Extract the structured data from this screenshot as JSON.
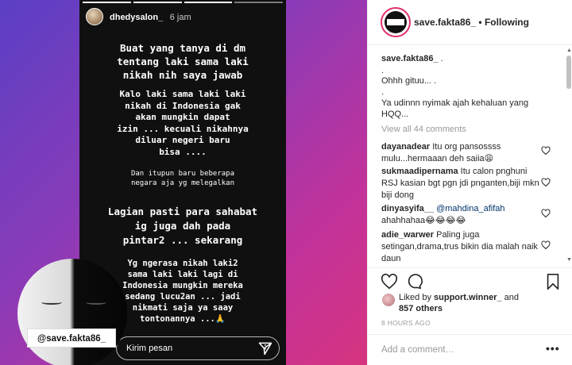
{
  "story": {
    "username": "dhedysalon_",
    "time": "6 jam",
    "text_block_1": "Buat yang tanya di dm\ntentang laki sama laki\nnikah nih saya jawab",
    "text_block_2": "Kalo laki sama laki laki\nnikah di Indonesia gak\nakan mungkin dapat\nizin ... kecuali nikahnya\ndiluar negeri baru\nbisa ....",
    "text_block_3": "Dan itupun baru beberapa\nnegara aja yg melegalkan",
    "text_block_4": "Lagian pasti para sahabat\nig juga dah pada\npintar2 ... sekarang",
    "text_block_5": "Yg ngerasa nikah laki2\nsama laki laki lagi di\nIndonesia mungkin mereka\nsedang lucu2an ... jadi\nnikmati saja ya saay\ntontonannya ...🙏",
    "reply_placeholder": "Kirim pesan",
    "more_glyph": "⋮"
  },
  "watermark": "@save.fakta86_",
  "post": {
    "header": {
      "username": "save.fakta86_",
      "following": "• Following"
    },
    "caption_user": "save.fakta86_",
    "caption_lines": [
      " .",
      ".",
      "Ohhh gituu... .",
      ".",
      "Ya udinnn nyimak ajah kehaluan yang",
      "HQQ..."
    ],
    "view_all": "View all 44 comments",
    "comments": [
      {
        "user": "dayanadear",
        "text": " Itu org pansossss mulu...hermaaan deh saiia😩"
      },
      {
        "user": "sukmaadipernama",
        "text": " Itu calon pnghuni RSJ kasian bgt pgn jdi pnganten,biji mkn biji dong"
      },
      {
        "user": "dinyasyifa__",
        "mention": " @mahdina_afifah",
        "text": " ahahhahaa😂😂😂😂"
      },
      {
        "user": "adie_warwer",
        "text": " Paling juga setingan,drama,trus bikin dia malah naik daun"
      }
    ],
    "liked_prefix": "Liked by ",
    "liked_user": "support.winner_",
    "liked_and": " and",
    "liked_others": "857 others",
    "timestamp": "8 HOURS AGO",
    "add_comment_placeholder": "Add a comment…",
    "more_dots": "•••"
  },
  "icons": {
    "heart": "heart-icon",
    "comment": "comment-icon",
    "bookmark": "bookmark-icon",
    "send": "send-icon"
  },
  "colors": {
    "mention": "#003569",
    "muted": "#999999",
    "ring": "#e1306c"
  }
}
